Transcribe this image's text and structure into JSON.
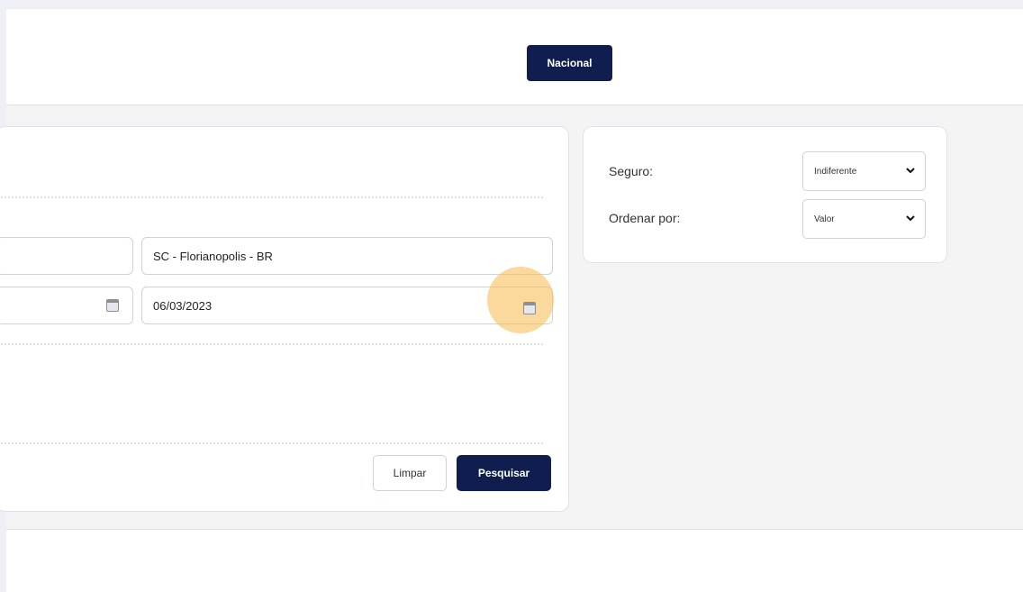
{
  "header": {
    "tabs": [
      {
        "label": "Nacional",
        "active": true
      }
    ]
  },
  "search_form": {
    "destination": {
      "value": "SC - Florianopolis - BR"
    },
    "return_date": {
      "value": "06/03/2023"
    },
    "buttons": {
      "clear_label": "Limpar",
      "search_label": "Pesquisar"
    }
  },
  "filters": {
    "insurance": {
      "label": "Seguro:",
      "selected": "Indiferente"
    },
    "sort_by": {
      "label": "Ordenar por:",
      "selected": "Valor"
    }
  },
  "colors": {
    "primary": "#0f1e4e",
    "highlight": "#f8be5a",
    "background": "#f5f4f5"
  },
  "icons": [
    "calendar-icon",
    "chevron-down-icon"
  ]
}
